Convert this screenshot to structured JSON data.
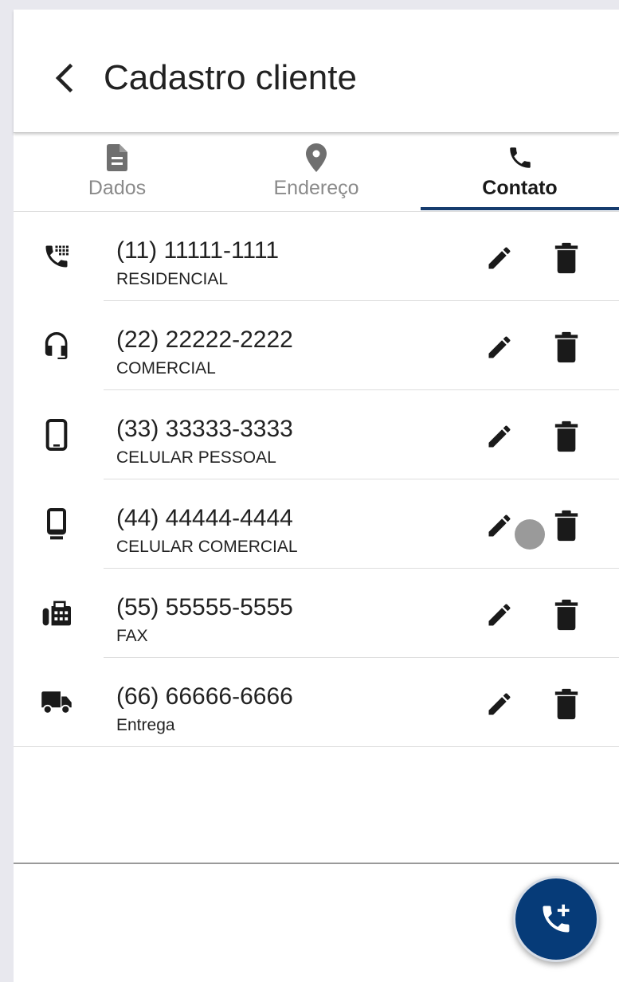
{
  "header": {
    "title": "Cadastro cliente",
    "back_icon": "chevron-left-icon"
  },
  "tabs": [
    {
      "label": "Dados",
      "icon": "document-icon",
      "active": false
    },
    {
      "label": "Endereço",
      "icon": "location-pin-icon",
      "active": false
    },
    {
      "label": "Contato",
      "icon": "phone-icon",
      "active": true
    }
  ],
  "contacts": [
    {
      "number": "(11) 11111-1111",
      "type": "RESIDENCIAL",
      "icon": "dialpad-phone-icon"
    },
    {
      "number": "(22) 22222-2222",
      "type": "COMERCIAL",
      "icon": "headset-icon"
    },
    {
      "number": "(33) 33333-3333",
      "type": "CELULAR PESSOAL",
      "icon": "smartphone-icon"
    },
    {
      "number": "(44) 44444-4444",
      "type": "CELULAR COMERCIAL",
      "icon": "mobile-device-icon"
    },
    {
      "number": "(55) 55555-5555",
      "type": "FAX",
      "icon": "fax-icon"
    },
    {
      "number": "(66) 66666-6666",
      "type": "Entrega",
      "icon": "delivery-truck-icon"
    }
  ],
  "actions": {
    "edit_icon": "pencil-icon",
    "delete_icon": "trash-icon"
  },
  "fab": {
    "icon": "add-phone-icon"
  },
  "colors": {
    "accent": "#163c6e",
    "fab_background": "#063b78",
    "text": "#222222",
    "inactive_tab": "#8a8a8a"
  }
}
